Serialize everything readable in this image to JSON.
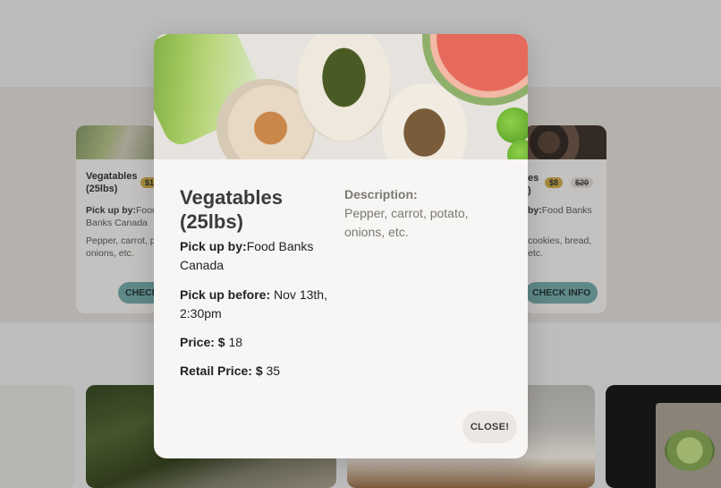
{
  "background": {
    "left_card": {
      "title": "Vegatables (25lbs)",
      "price_badge": "$1",
      "pickup_label": "Pick up by:",
      "pickup_value": "Food Banks Canada",
      "description": "Pepper, carrot, p onions, etc.",
      "button": "CHECK INFO"
    },
    "right_card": {
      "title": "es )",
      "price_badge": "$8",
      "retail_badge": "$20",
      "pickup_label": "by:",
      "pickup_value": "Food Banks",
      "description": "cookies, bread, etc.",
      "button": "CHECK INFO"
    }
  },
  "modal": {
    "title": "Vegatables (25lbs)",
    "pickup_by_label": "Pick up by:",
    "pickup_by_value": "Food Banks Canada",
    "pickup_before_label": "Pick up before:",
    "pickup_before_value": " Nov 13th, 2:30pm",
    "price_label": "Price: $",
    "price_value": " 18",
    "retail_price_label": "Retail Price: $",
    "retail_price_value": " 35",
    "description_label": "Description:",
    "description": "Pepper, carrot, potato, onions, etc.",
    "close_button": "CLOSE!"
  }
}
